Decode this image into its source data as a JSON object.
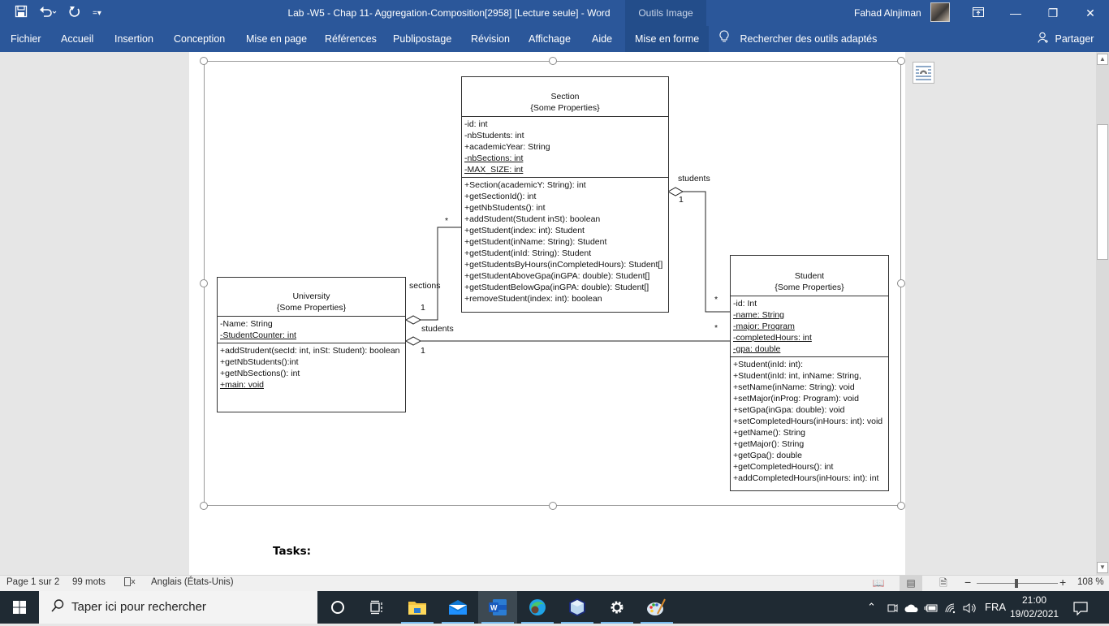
{
  "window": {
    "title": "Lab -W5 - Chap 11- Aggregation-Composition[2958] [Lecture seule]  -  Word",
    "context_group": "Outils Image",
    "user_name": "Fahad Alnjiman",
    "qat": {
      "save": "save-icon",
      "undo": "undo-icon",
      "redo": "redo-icon",
      "customize": "customize-qat-icon"
    },
    "controls": {
      "ribbon_display": "ribbon-display-icon",
      "minimize": "—",
      "restore": "❐",
      "close": "✕"
    }
  },
  "ribbon": {
    "tabs": [
      {
        "label": "Fichier"
      },
      {
        "label": "Accueil"
      },
      {
        "label": "Insertion"
      },
      {
        "label": "Conception"
      },
      {
        "label": "Mise en page"
      },
      {
        "label": "Références"
      },
      {
        "label": "Publipostage"
      },
      {
        "label": "Révision"
      },
      {
        "label": "Affichage"
      },
      {
        "label": "Aide"
      },
      {
        "label": "Mise en forme"
      }
    ],
    "tell_me": "Rechercher des outils adaptés",
    "share": "Partager"
  },
  "diagram": {
    "classes": {
      "section": {
        "name": "Section",
        "properties": "{Some Properties}",
        "attributes": [
          {
            "text": "-id: int",
            "static": false
          },
          {
            "text": "-nbStudents: int",
            "static": false
          },
          {
            "text": "+academicYear: String",
            "static": false
          },
          {
            "text": "-nbSections: int",
            "static": true
          },
          {
            "text": "-MAX_SIZE: int",
            "static": true
          }
        ],
        "operations": [
          {
            "text": "+Section(academicY: String): int",
            "static": false
          },
          {
            "text": "+getSectionId(): int",
            "static": false
          },
          {
            "text": "+getNbStudents(): int",
            "static": false
          },
          {
            "text": "+addStudent(Student inSt): boolean",
            "static": false
          },
          {
            "text": "+getStudent(index: int): Student",
            "static": false
          },
          {
            "text": "+getStudent(inName: String): Student",
            "static": false
          },
          {
            "text": "+getStudent(inId: String): Student",
            "static": false
          },
          {
            "text": "+getStudentsByHours(inCompletedHours): Student[]",
            "static": false
          },
          {
            "text": "+getStudentAboveGpa(inGPA: double): Student[]",
            "static": false
          },
          {
            "text": "+getStudentBelowGpa(inGPA: double): Student[]",
            "static": false
          },
          {
            "text": "+removeStudent(index: int): boolean",
            "static": false
          }
        ]
      },
      "university": {
        "name": "University",
        "properties": "{Some Properties}",
        "attributes": [
          {
            "text": "-Name: String",
            "static": false
          },
          {
            "text": "-StudentCounter: int",
            "static": true
          }
        ],
        "operations": [
          {
            "text": "+addStrudent(secId: int, inSt: Student): boolean",
            "static": false
          },
          {
            "text": "+getNbStudents():int",
            "static": false
          },
          {
            "text": "+getNbSections(): int",
            "static": false
          },
          {
            "text": "+main: void",
            "static": true
          }
        ]
      },
      "student": {
        "name": "Student",
        "properties": "{Some Properties}",
        "attributes": [
          {
            "text": "-id: Int",
            "static": false
          },
          {
            "text": "-name: String",
            "static": true
          },
          {
            "text": "-major: Program",
            "static": true
          },
          {
            "text": "-completedHours: int",
            "static": true
          },
          {
            "text": "-gpa: double",
            "static": true
          }
        ],
        "operations": [
          {
            "text": "+Student(inId: int):",
            "static": false
          },
          {
            "text": "+Student(inId: int, inName: String,",
            "static": false
          },
          {
            "text": "+setName(inName: String): void",
            "static": false
          },
          {
            "text": "+setMajor(inProg: Program): void",
            "static": false
          },
          {
            "text": "+setGpa(inGpa: double): void",
            "static": false
          },
          {
            "text": "+setCompletedHours(inHours: int): void",
            "static": false
          },
          {
            "text": "+getName(): String",
            "static": false
          },
          {
            "text": "+getMajor(): String",
            "static": false
          },
          {
            "text": "+getGpa(): double",
            "static": false
          },
          {
            "text": "+getCompletedHours(): int",
            "static": false
          },
          {
            "text": "+addCompletedHours(inHours: int): int",
            "static": false
          }
        ]
      }
    },
    "associations": [
      {
        "from": "University",
        "to": "Section",
        "kind": "aggregation",
        "role": "sections",
        "from_mult": "1",
        "to_mult": "*"
      },
      {
        "from": "University",
        "to": "Student",
        "kind": "aggregation",
        "role": "students",
        "from_mult": "1",
        "to_mult": "*"
      },
      {
        "from": "Section",
        "to": "Student",
        "kind": "aggregation",
        "role": "students",
        "from_mult": "1",
        "to_mult": "*"
      }
    ]
  },
  "document": {
    "tasks_heading": "Tasks:"
  },
  "statusbar": {
    "page": "Page 1 sur 2",
    "words": "99 mots",
    "language": "Anglais (États-Unis)",
    "zoom_minus": "−",
    "zoom_plus": "+",
    "zoom_level": "108 %",
    "zoom_percent": 108
  },
  "taskbar": {
    "search_placeholder": "Taper ici pour rechercher",
    "apps": [
      "cortana",
      "task-view",
      "file-explorer",
      "mail",
      "word",
      "edge",
      "3d-viewer",
      "settings",
      "paint"
    ],
    "active_app": "word",
    "language": "FRA",
    "time": "21:00",
    "date": "19/02/2021"
  }
}
